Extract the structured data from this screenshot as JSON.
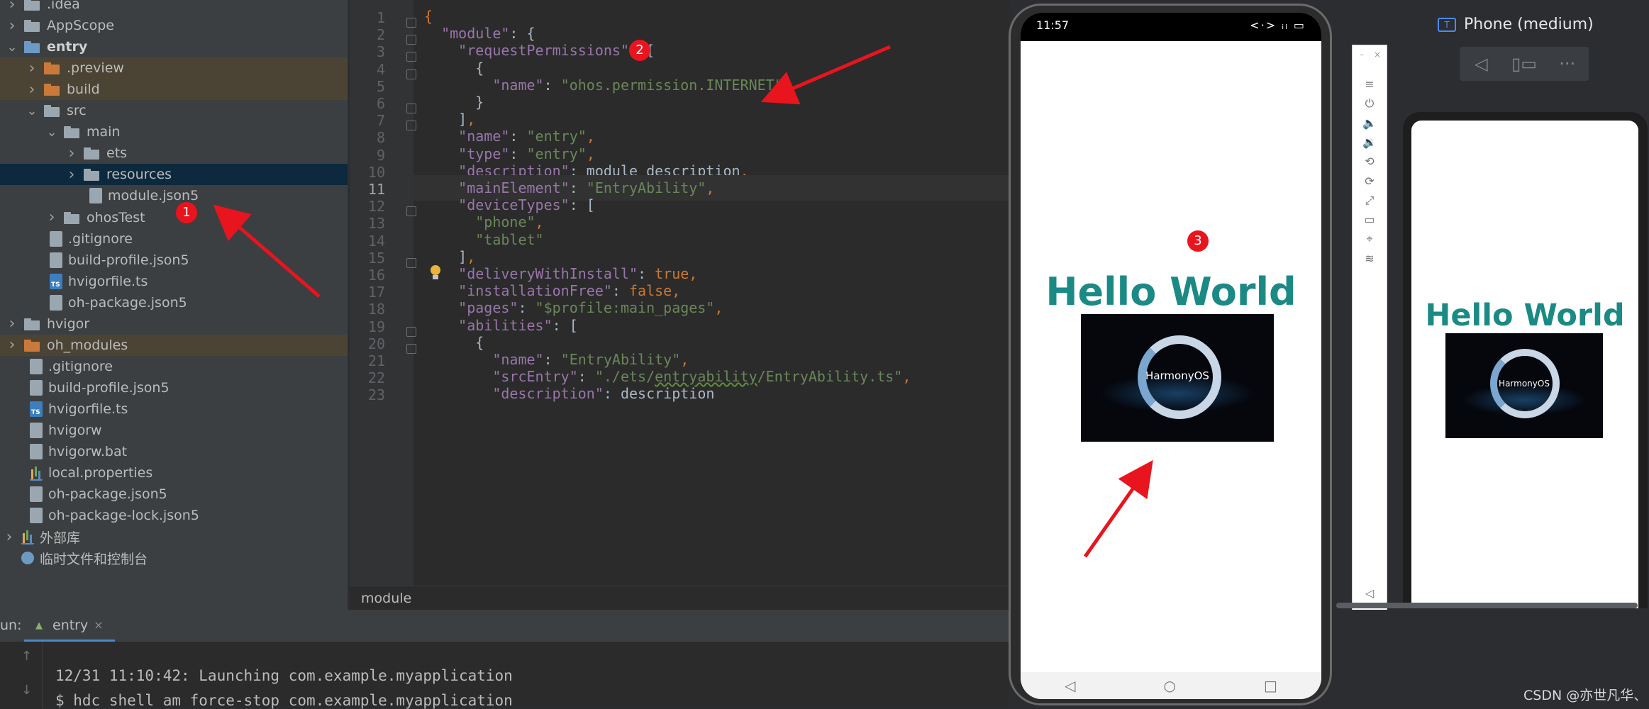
{
  "project_tree": [
    {
      "label": ".idea",
      "level": 0,
      "type": "folder",
      "expand": "collapsed"
    },
    {
      "label": "AppScope",
      "level": 0,
      "type": "folder",
      "expand": "collapsed"
    },
    {
      "label": "entry",
      "level": 0,
      "type": "folder-blue",
      "expand": "expanded",
      "bold": true
    },
    {
      "label": ".preview",
      "level": 1,
      "type": "folder-orange",
      "expand": "collapsed",
      "highlight": true
    },
    {
      "label": "build",
      "level": 1,
      "type": "folder-orange",
      "expand": "collapsed",
      "highlight": true
    },
    {
      "label": "src",
      "level": 1,
      "type": "folder",
      "expand": "expanded"
    },
    {
      "label": "main",
      "level": 2,
      "type": "folder",
      "expand": "expanded"
    },
    {
      "label": "ets",
      "level": 3,
      "type": "folder",
      "expand": "collapsed"
    },
    {
      "label": "resources",
      "level": 3,
      "type": "folder",
      "expand": "collapsed",
      "selected": true
    },
    {
      "label": "module.json5",
      "level": 3,
      "type": "file",
      "expand": "none"
    },
    {
      "label": "ohosTest",
      "level": 2,
      "type": "folder",
      "expand": "collapsed"
    },
    {
      "label": ".gitignore",
      "level": 1,
      "type": "file",
      "expand": "none"
    },
    {
      "label": "build-profile.json5",
      "level": 1,
      "type": "file",
      "expand": "none"
    },
    {
      "label": "hvigorfile.ts",
      "level": 1,
      "type": "file-ts",
      "expand": "none"
    },
    {
      "label": "oh-package.json5",
      "level": 1,
      "type": "file",
      "expand": "none"
    },
    {
      "label": "hvigor",
      "level": 0,
      "type": "folder",
      "expand": "collapsed"
    },
    {
      "label": "oh_modules",
      "level": 0,
      "type": "folder-orange",
      "expand": "collapsed",
      "highlight": true
    },
    {
      "label": ".gitignore",
      "level": 0,
      "type": "file",
      "expand": "none"
    },
    {
      "label": "build-profile.json5",
      "level": 0,
      "type": "file",
      "expand": "none"
    },
    {
      "label": "hvigorfile.ts",
      "level": 0,
      "type": "file-ts",
      "expand": "none"
    },
    {
      "label": "hvigorw",
      "level": 0,
      "type": "file",
      "expand": "none"
    },
    {
      "label": "hvigorw.bat",
      "level": 0,
      "type": "file",
      "expand": "none"
    },
    {
      "label": "local.properties",
      "level": 0,
      "type": "file-bars",
      "expand": "none"
    },
    {
      "label": "oh-package.json5",
      "level": 0,
      "type": "file",
      "expand": "none"
    },
    {
      "label": "oh-package-lock.json5",
      "level": 0,
      "type": "file",
      "expand": "none"
    },
    {
      "label": "外部库",
      "level": -1,
      "type": "lib",
      "expand": "collapsed"
    },
    {
      "label": "临时文件和控制台",
      "level": -1,
      "type": "console",
      "expand": "none"
    }
  ],
  "editor": {
    "current_line": 11,
    "lines": [
      [
        [
          "p",
          "{"
        ]
      ],
      [
        [
          "k",
          "  \"module\""
        ],
        [
          "t",
          ": {"
        ]
      ],
      [
        [
          "k",
          "    \"requestPermissions\""
        ],
        [
          "t",
          ": ["
        ]
      ],
      [
        [
          "t",
          "      {"
        ]
      ],
      [
        [
          "k",
          "        \"name\""
        ],
        [
          "t",
          ": "
        ],
        [
          "s",
          "\"ohos.permission.INTERNET\""
        ]
      ],
      [
        [
          "t",
          "      }"
        ]
      ],
      [
        [
          "t",
          "    ]"
        ],
        [
          "p",
          ","
        ]
      ],
      [
        [
          "k",
          "    \"name\""
        ],
        [
          "t",
          ": "
        ],
        [
          "s",
          "\"entry\""
        ],
        [
          "p",
          ","
        ]
      ],
      [
        [
          "k",
          "    \"type\""
        ],
        [
          "t",
          ": "
        ],
        [
          "s",
          "\"entry\""
        ],
        [
          "p",
          ","
        ]
      ],
      [
        [
          "k",
          "    \"description\""
        ],
        [
          "t",
          ": module description"
        ],
        [
          "p",
          ","
        ]
      ],
      [
        [
          "k",
          "    \"mainElement\""
        ],
        [
          "t",
          ": "
        ],
        [
          "s",
          "\"EntryAbility\""
        ],
        [
          "p",
          ","
        ]
      ],
      [
        [
          "k",
          "    \"deviceTypes\""
        ],
        [
          "t",
          ": ["
        ]
      ],
      [
        [
          "s",
          "      \"phone\""
        ],
        [
          "p",
          ","
        ]
      ],
      [
        [
          "s",
          "      \"tablet\""
        ]
      ],
      [
        [
          "t",
          "    ]"
        ],
        [
          "p",
          ","
        ]
      ],
      [
        [
          "k",
          "    \"deliveryWithInstall\""
        ],
        [
          "t",
          ": "
        ],
        [
          "b",
          "true"
        ],
        [
          "p",
          ","
        ]
      ],
      [
        [
          "k",
          "    \"installationFree\""
        ],
        [
          "t",
          ": "
        ],
        [
          "b",
          "false"
        ],
        [
          "p",
          ","
        ]
      ],
      [
        [
          "k",
          "    \"pages\""
        ],
        [
          "t",
          ": "
        ],
        [
          "s",
          "\"$profile:main_pages\""
        ],
        [
          "p",
          ","
        ]
      ],
      [
        [
          "k",
          "    \"abilities\""
        ],
        [
          "t",
          ": ["
        ]
      ],
      [
        [
          "t",
          "      {"
        ]
      ],
      [
        [
          "k",
          "        \"name\""
        ],
        [
          "t",
          ": "
        ],
        [
          "s",
          "\"EntryAbility\""
        ],
        [
          "p",
          ","
        ]
      ],
      [
        [
          "k",
          "        \"srcEntry\""
        ],
        [
          "t",
          ": "
        ],
        [
          "s",
          "\"./ets/"
        ],
        [
          "u",
          "entryability"
        ],
        [
          "s",
          "/EntryAbility.ts\""
        ],
        [
          "p",
          ","
        ]
      ],
      [
        [
          "k",
          "        \"description\""
        ],
        [
          "t",
          ": description"
        ]
      ]
    ],
    "breadcrumb": "module"
  },
  "phone": {
    "time": "11:57",
    "status_icons": "<·> ᵢₗ ▭",
    "hello": "Hello World",
    "image_text": "HarmonyOS",
    "nav": [
      "◁",
      "○",
      "□"
    ]
  },
  "side_toolbar": {
    "min": "–",
    "close": "×",
    "buttons": [
      "≡",
      "⏻",
      "🔈",
      "🔉",
      "⟲",
      "⟳",
      "⤢",
      "▭",
      "⌖",
      "≋"
    ],
    "bottom_buttons": [
      "◁",
      "○",
      "□"
    ]
  },
  "preview_panel": {
    "title": "Phone (medium)",
    "title_icon": "T",
    "tools": [
      "◁",
      "▯▭",
      "···"
    ],
    "hello": "Hello World",
    "image_text": "HarmonyOS"
  },
  "run_panel": {
    "label": "un:",
    "tab": "entry",
    "tab_close": "×",
    "side_icons": [
      "↑",
      "↓"
    ],
    "log": [
      "12/31 11:10:42: Launching com.example.myapplication",
      "$ hdc shell am force-stop com.example.myapplication"
    ]
  },
  "annotations": {
    "badge1": "1",
    "badge2": "2",
    "badge3": "3",
    "color": "#e8141e"
  },
  "watermark": "CSDN @亦世凡华、"
}
